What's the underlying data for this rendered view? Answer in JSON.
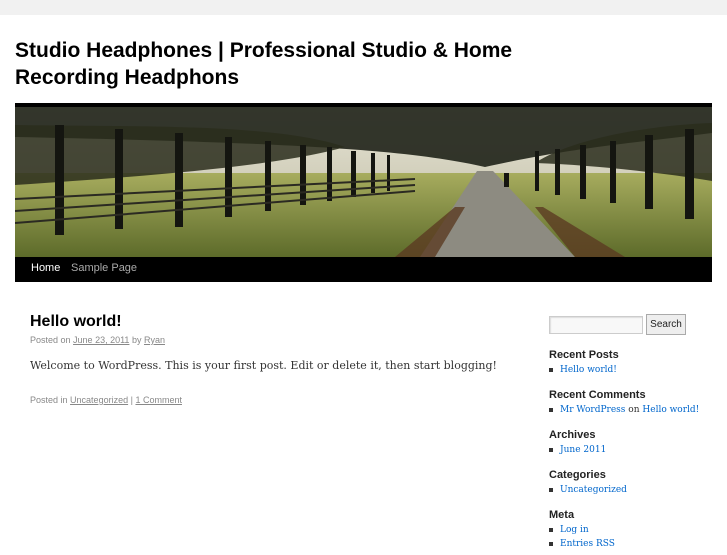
{
  "site": {
    "title": "Studio Headphones | Professional Studio & Home Recording Headphons"
  },
  "nav": {
    "items": [
      {
        "label": "Home"
      },
      {
        "label": "Sample Page"
      }
    ]
  },
  "post": {
    "title": "Hello world!",
    "meta_posted_on": "Posted on",
    "date": "June 23, 2011",
    "by": "by",
    "author": "Ryan",
    "content": "Welcome to WordPress. This is your first post. Edit or delete it, then start blogging!",
    "posted_in": "Posted in",
    "category": "Uncategorized",
    "separator": "|",
    "comments": "1 Comment"
  },
  "sidebar": {
    "search": {
      "value": "",
      "button": "Search"
    },
    "recent_posts": {
      "title": "Recent Posts",
      "items": [
        "Hello world!"
      ]
    },
    "recent_comments": {
      "title": "Recent Comments",
      "author": "Mr WordPress",
      "on": "on",
      "post": "Hello world!"
    },
    "archives": {
      "title": "Archives",
      "items": [
        "June 2011"
      ]
    },
    "categories": {
      "title": "Categories",
      "items": [
        "Uncategorized"
      ]
    },
    "meta": {
      "title": "Meta",
      "items": [
        "Log in",
        "Entries RSS"
      ]
    }
  },
  "colors": {
    "link": "#0066cc",
    "nav_bg": "#000000",
    "page_bg": "#f1f1f1"
  }
}
